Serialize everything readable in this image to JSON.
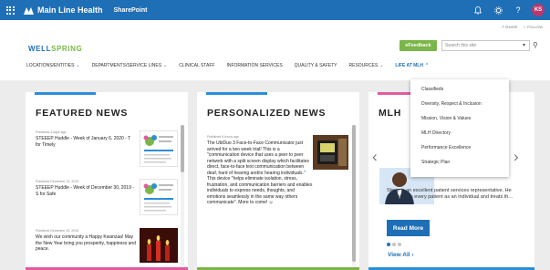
{
  "suitebar": {
    "brand": "Main Line Health",
    "app": "SharePoint",
    "avatar_initials": "KS"
  },
  "share_row": {
    "share": "SHARE",
    "follow": "FOLLOW"
  },
  "site": {
    "logo_part1": "WELL",
    "logo_part2": "SPRING",
    "efeedback": "eFeedback",
    "search_placeholder": "Search this site"
  },
  "nav": [
    {
      "label": "LOCATIONS/ENTITIES",
      "chevron": true
    },
    {
      "label": "DEPARTMENTS/SERVICE LINES",
      "chevron": true
    },
    {
      "label": "CLINICAL STAFF",
      "chevron": false
    },
    {
      "label": "INFORMATION SERVICES",
      "chevron": false
    },
    {
      "label": "QUALITY & SAFETY",
      "chevron": false
    },
    {
      "label": "RESOURCES",
      "chevron": true
    },
    {
      "label": "LIFE AT MLH",
      "chevron": true
    }
  ],
  "featured": {
    "title": "FEATURED NEWS",
    "items": [
      {
        "date": "Published 3 days ago",
        "text": "STEEEP Huddle - Week of January 6, 2020 - T for Timely"
      },
      {
        "date": "Published December 23, 2019",
        "text": "STEEEP Huddle - Week of December 30, 2019 - S for Safe"
      },
      {
        "date": "Published December 20, 2019",
        "text": "We wish our community a Happy Kwanzaa! May the New Year bring you prosperity, happiness and peace."
      }
    ]
  },
  "personalized": {
    "title": "PERSONALIZED NEWS",
    "date": "Published 6 hours ago",
    "text": "The UbiDuo 3 Face-to-Face Communicator just arrived for a two week trial! This is a \"communication device that uses a peer to peer network with a split screen display which facilitates direct, face-to-face text communication between deaf, hard of hearing and/or hearing individuals.\" This device \"helps eliminate isolation, stress, frustration, and communication barriers and enables individuals to express needs, thoughts, and emotions seamlessly in the same way others communicate\". More to come! ☺"
  },
  "mlh": {
    "title": "MLH",
    "caption": "Steve is an excellent patient services representative. He approaches every patient as an individual and treats th...",
    "read_more": "Read More",
    "view_all": "View All ›"
  },
  "life_menu": [
    "Classifieds",
    "Diversity, Respect & Inclusion",
    "Mission, Vision & Values",
    "MLH Directory",
    "Performance Excellence",
    "Strategic Plan"
  ],
  "colors": {
    "brand_blue": "#1f6fb6",
    "brand_green": "#7ab648",
    "accent_blue": "#2b8ed8",
    "avatar": "#b8396b"
  }
}
